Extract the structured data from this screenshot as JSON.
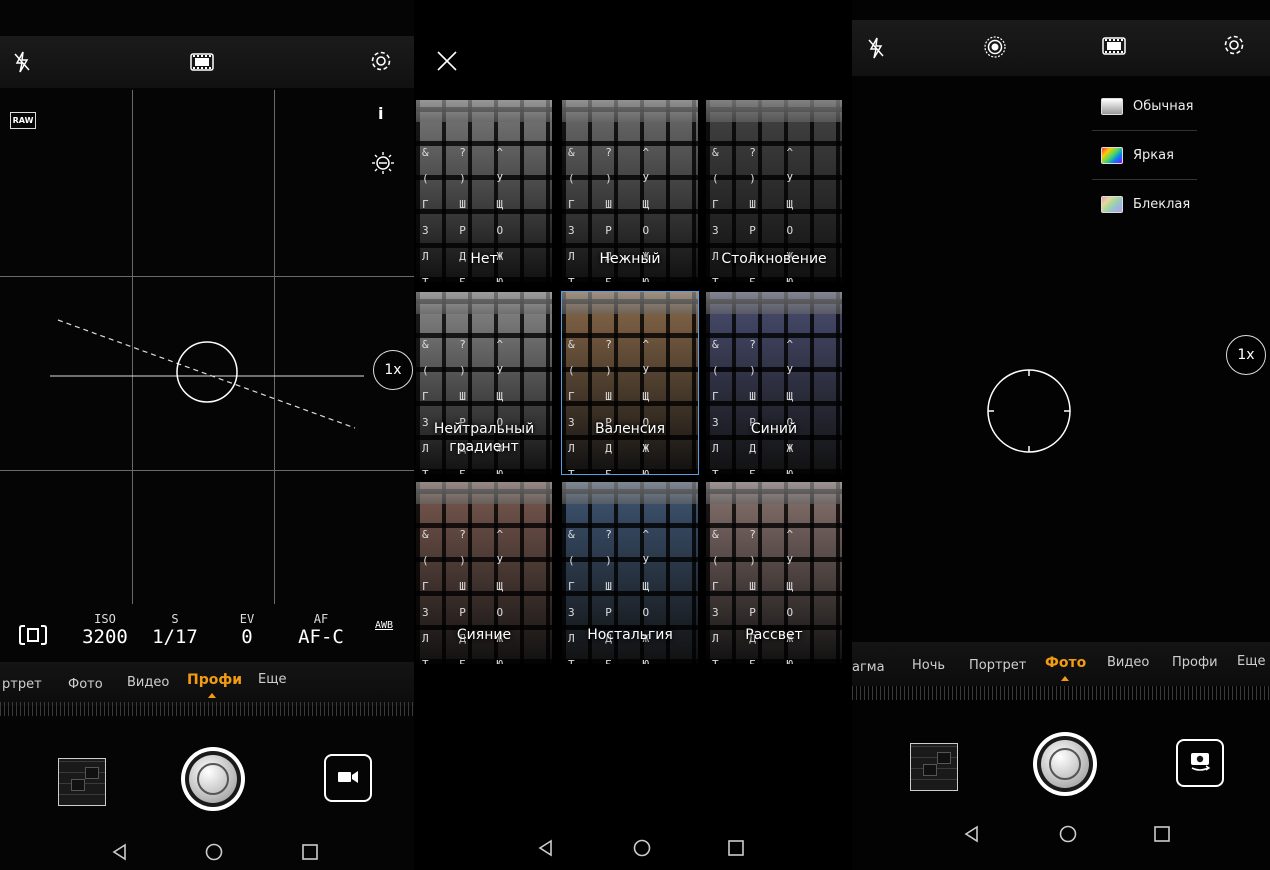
{
  "left": {
    "raw_label": "RAW",
    "info_label": "i",
    "zoom": "1x",
    "pro": [
      {
        "label": "ISO",
        "value": "3200"
      },
      {
        "label": "S",
        "value": "1/17"
      },
      {
        "label": "EV",
        "value": "0"
      },
      {
        "label": "AF",
        "value": "AF-C"
      }
    ],
    "wb_label": "AWB",
    "modes": [
      "ртрет",
      "Фото",
      "Видео",
      "Профи",
      "Еще"
    ],
    "active_mode": "Профи"
  },
  "middle": {
    "filters": [
      {
        "name": "Нет",
        "tint": "#7b7b7b"
      },
      {
        "name": "Нежный",
        "tint": "#6d6d6d"
      },
      {
        "name": "Столкновение",
        "tint": "#444444"
      },
      {
        "name": "Нейтральный градиент",
        "tint": "#8a8a8a"
      },
      {
        "name": "Валенсия",
        "tint": "#8a6a4a"
      },
      {
        "name": "Синий",
        "tint": "#4a4e70"
      },
      {
        "name": "Сияние",
        "tint": "#7a5a50"
      },
      {
        "name": "Ностальгия",
        "tint": "#3f5674"
      },
      {
        "name": "Рассвет",
        "tint": "#8a7470"
      }
    ],
    "selected": "Валенсия",
    "key_text": "& ? ^ ( ) У Г Ш Щ З Р О Л Д Ж Т Б Ю"
  },
  "right": {
    "zoom": "1x",
    "color_modes": [
      {
        "label": "Обычная",
        "swatch": "#bbbbbb"
      },
      {
        "label": "Яркая",
        "swatch": "#ff3b6a"
      },
      {
        "label": "Блеклая",
        "swatch": "#a3c9a0"
      }
    ],
    "modes": [
      "агма",
      "Ночь",
      "Портрет",
      "Фото",
      "Видео",
      "Профи",
      "Еще"
    ],
    "active_mode": "Фото"
  },
  "colors": {
    "accent": "#f39c12",
    "selected_border": "#5aa0e0"
  }
}
